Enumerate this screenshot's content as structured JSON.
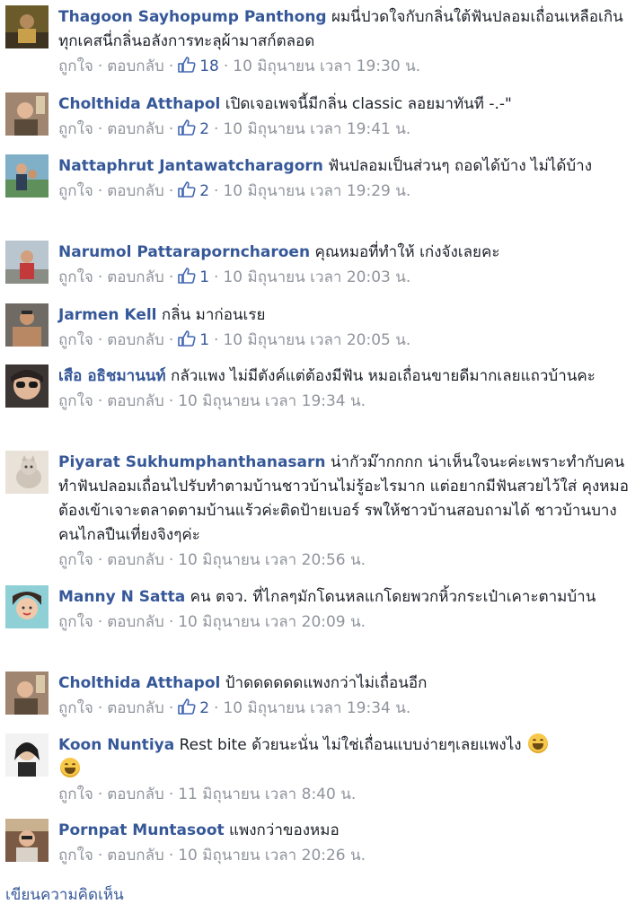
{
  "labels": {
    "like": "ถูกใจ",
    "reply": "ตอบกลับ",
    "write_comment": "เขียนความคิดเห็น"
  },
  "comments": [
    {
      "name": "Thagoon Sayhopump Panthong",
      "message": "ผมนี่ปวดใจกับกลิ่นใต้ฟันปลอมเถื่อนเหลือเกิน ทุกเคสนี่กลิ่นอลังการทะลุผ้ามาสก์ตลอด",
      "likes": "18",
      "time": "10 มิถุนายน เวลา 19:30 น."
    },
    {
      "name": "Cholthida Atthapol",
      "message": "เปิดเจอเพจนี้มีกลิ่น classic ลอยมาทันที -.-\"",
      "likes": "2",
      "time": "10 มิถุนายน เวลา 19:41 น."
    },
    {
      "name": "Nattaphrut Jantawatcharagorn",
      "message": "ฟันปลอมเป็นส่วนๆ ถอดได้บ้าง ไม่ได้บ้าง",
      "likes": "2",
      "time": "10 มิถุนายน เวลา 19:29 น."
    },
    {
      "name": "Narumol Pattaraporncharoen",
      "message": "คุณหมอที่ทำให้ เก่งจังเลยคะ",
      "likes": "1",
      "time": "10 มิถุนายน เวลา 20:03 น."
    },
    {
      "name": "Jarmen Kell",
      "message": "กลิ่น มาก่อนเรย",
      "likes": "1",
      "time": "10 มิถุนายน เวลา 20:05 น."
    },
    {
      "name": "เสือ อธิชมานนท์",
      "message": "กลัวแพง ไม่มีตังค์แต่ต้องมีฟัน หมอเถื่อนขายดีมากเลยแถวบ้านคะ",
      "likes": "",
      "time": "10 มิถุนายน เวลา 19:34 น."
    },
    {
      "name": "Piyarat Sukhumphanthanasarn",
      "message": "น่ากัวม๊ากกกก น่าเห็นใจนะค่ะเพราะทำกับคนทำฟันปลอมเถื่อนไปรับทำตามบ้านชาวบ้านไม่รู้อะไรมาก แต่อยากมีฟันสวยไว้ใส่ คุงหมอต้องเข้าเจาะตลาดตามบ้านแร้วค่ะติดป้ายเบอร์ รพให้ชาวบ้านสอบถามได้ ชาวบ้านบางคนไกลปืนเที่ยงจิงๆค่ะ",
      "likes": "",
      "time": "10 มิถุนายน เวลา 20:56 น."
    },
    {
      "name": "Manny N Satta",
      "message": "คน ตจว. ที่ไกลๆมักโดนหลแกโดยพวกหิ้วกระเป๋าเคาะตามบ้าน",
      "likes": "",
      "time": "10 มิถุนายน เวลา 20:09 น."
    },
    {
      "name": "Cholthida Atthapol",
      "message": "ป้าดดดดดดแพงกว่าไม่เถื่อนอีก",
      "likes": "2",
      "time": "10 มิถุนายน เวลา 19:34 น."
    },
    {
      "name": "Koon Nuntiya",
      "message": "Rest bite ด้วยนะนั่น ไม่ใช่เถื่อนแบบง่ายๆเลยแพงไง",
      "likes": "",
      "time": "11 มิถุนายน เวลา 8:40 น."
    },
    {
      "name": "Pornpat Muntasoot",
      "message": "แพงกว่าของหมอ",
      "likes": "",
      "time": "10 มิถุนายน เวลา 20:26 น."
    }
  ],
  "colors": {
    "name": "#365899",
    "meta": "#90949c",
    "text": "#1d2129"
  }
}
